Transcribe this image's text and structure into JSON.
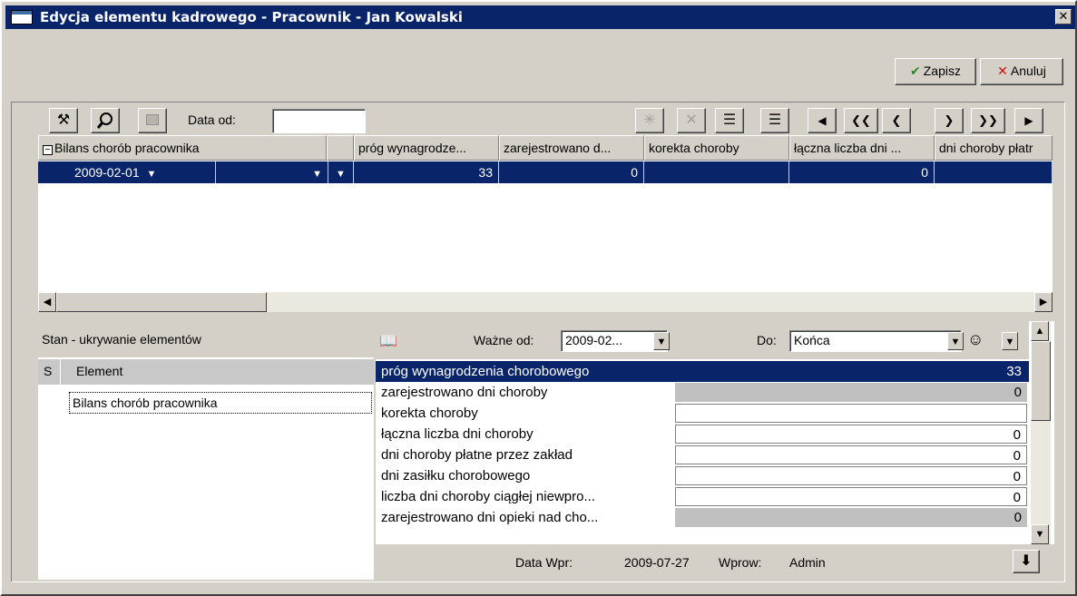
{
  "window": {
    "title": "Edycja elementu kadrowego - Pracownik - Jan Kowalski",
    "close_glyph": "✕"
  },
  "actions": {
    "save_label": "Zapisz",
    "save_icon": "check-icon",
    "save_glyph": "✔",
    "cancel_label": "Anuluj",
    "cancel_icon": "x-icon",
    "cancel_glyph": "✕"
  },
  "toolbar": {
    "date_from_label": "Data od:",
    "date_from_value": "",
    "nav_glyphs": [
      "◀",
      "❮❮",
      "❮",
      "❯",
      "❯❯",
      "▶"
    ]
  },
  "grid": {
    "tree_header": "Bilans chorób pracownika",
    "columns": [
      "próg wynagrodze...",
      "zarejestrowano d...",
      "korekta choroby",
      "łączna liczba dni ...",
      "dni choroby płatr"
    ],
    "row": {
      "date": "2009-02-01",
      "values": [
        "33",
        "0",
        "",
        "0",
        ""
      ]
    }
  },
  "left_pane": {
    "title": "Stan - ukrywanie elementów",
    "col_s": "S",
    "col_element": "Element",
    "items": [
      "Bilans chorób pracownika"
    ]
  },
  "detail": {
    "valid_from_label": "Ważne od:",
    "valid_from_value": "2009-02...",
    "to_label": "Do:",
    "to_value": "Końca",
    "fields": [
      {
        "label": "próg wynagrodzenia chorobowego",
        "value": "33",
        "style": "blue"
      },
      {
        "label": "zarejestrowano dni choroby",
        "value": "0",
        "style": "grey"
      },
      {
        "label": "korekta choroby",
        "value": "",
        "style": "white"
      },
      {
        "label": "łączna liczba dni choroby",
        "value": "0",
        "style": "white"
      },
      {
        "label": "dni choroby płatne przez zakład",
        "value": "0",
        "style": "white"
      },
      {
        "label": "dni zasiłku chorobowego",
        "value": "0",
        "style": "white"
      },
      {
        "label": "liczba dni choroby ciągłej niewpro...",
        "value": "0",
        "style": "white"
      },
      {
        "label": "zarejestrowano dni opieki nad cho...",
        "value": "0",
        "style": "grey"
      }
    ]
  },
  "footer": {
    "entry_date_label": "Data Wpr:",
    "entry_date_value": "2009-07-27",
    "entered_by_label": "Wprow:",
    "entered_by_value": "Admin"
  }
}
